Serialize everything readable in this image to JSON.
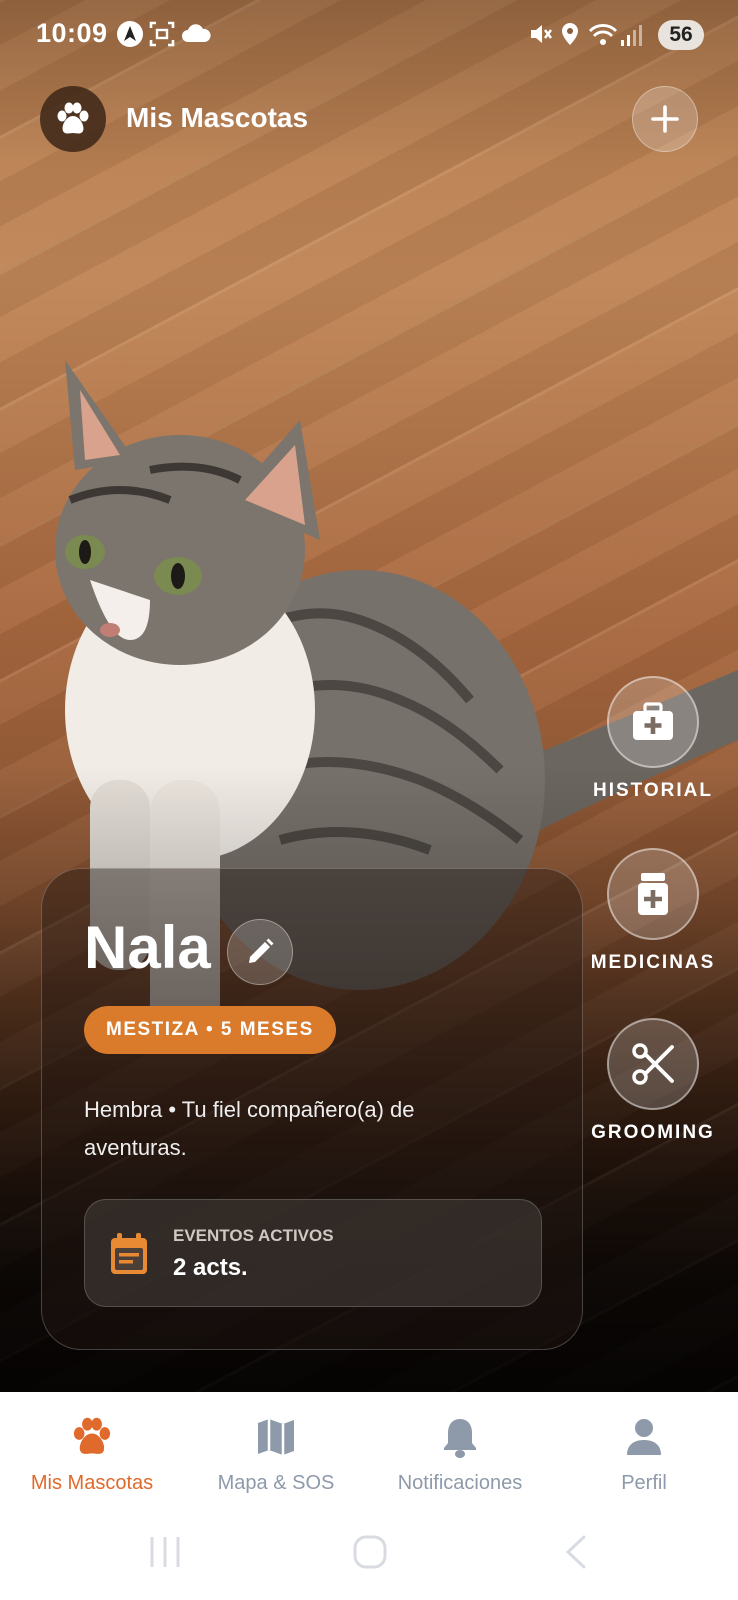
{
  "status_bar": {
    "time": "10:09",
    "battery": "56"
  },
  "header": {
    "title": "Mis Mascotas",
    "logo_icon": "paw-icon",
    "add_icon": "plus-icon"
  },
  "side_actions": [
    {
      "label": "HISTORIAL",
      "icon": "medical-kit-icon"
    },
    {
      "label": "MEDICINAS",
      "icon": "medicine-bottle-icon"
    },
    {
      "label": "GROOMING",
      "icon": "scissors-icon"
    }
  ],
  "pet": {
    "name": "Nala",
    "badge": "MESTIZA • 5 MESES",
    "description": "Hembra • Tu fiel compañero(a) de aventuras.",
    "events_label": "EVENTOS ACTIVOS",
    "events_value": "2 acts."
  },
  "bottom_nav": [
    {
      "label": "Mis Mascotas",
      "icon": "paw-icon",
      "active": true
    },
    {
      "label": "Mapa & SOS",
      "icon": "map-icon",
      "active": false
    },
    {
      "label": "Notificaciones",
      "icon": "bell-icon",
      "active": false
    },
    {
      "label": "Perfil",
      "icon": "person-icon",
      "active": false
    }
  ],
  "colors": {
    "accent": "#e06a2c",
    "badge": "#d97b2b",
    "nav_inactive": "#8e9aaa"
  }
}
